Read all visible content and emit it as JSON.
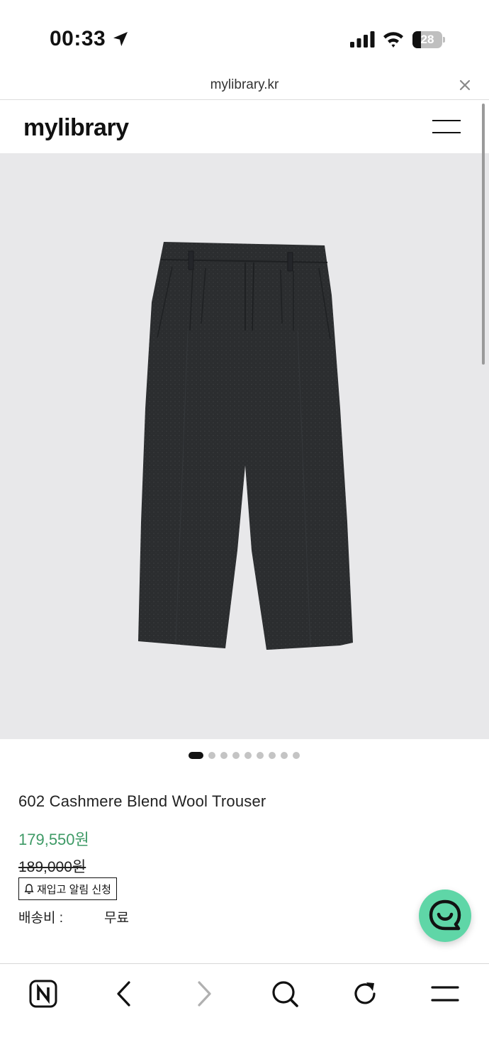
{
  "status_bar": {
    "time": "00:33",
    "battery_level": "28",
    "battery_fraction": 0.28,
    "icons": [
      "location-arrow-icon",
      "cellular-signal-icon",
      "wifi-icon",
      "battery-icon"
    ]
  },
  "browser": {
    "url": "mylibrary.kr",
    "close_icon": "close-icon"
  },
  "header": {
    "logo": "mylibrary",
    "menu_icon": "hamburger-menu-icon"
  },
  "gallery": {
    "image_count": 9,
    "active_index": 0,
    "image_background": "#e8e8ea",
    "product_color": "#2b2d2f"
  },
  "product": {
    "title": "602 Cashmere Blend Wool Trouser",
    "sale_price": "179,550원",
    "original_price": "189,000원",
    "restock_button": "재입고 알림 신청",
    "shipping_label": "배송비 :",
    "shipping_value": "무료",
    "price_color": "#3e9a66"
  },
  "chat": {
    "icon": "chat-bubble-icon",
    "color": "#5fd6a7"
  },
  "toolbar": {
    "icons": [
      "naver-home-icon",
      "back-arrow-icon",
      "forward-arrow-icon",
      "search-icon",
      "refresh-icon",
      "menu-icon"
    ]
  }
}
